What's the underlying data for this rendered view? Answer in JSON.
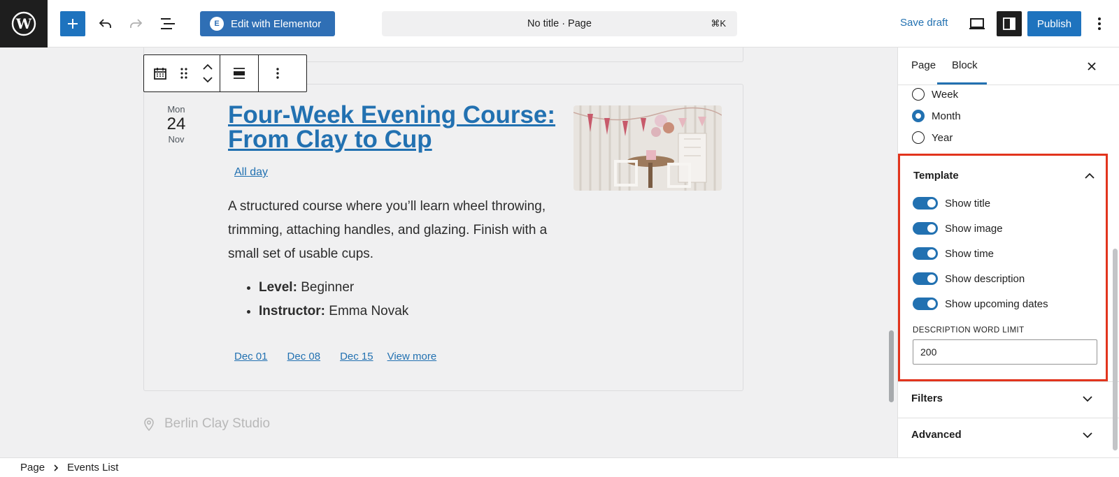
{
  "topbar": {
    "document_title": "No title · Page",
    "command_shortcut": "⌘K",
    "elementor_label": "Edit with Elementor",
    "save_draft_label": "Save draft",
    "publish_label": "Publish",
    "icons": [
      "wordpress-logo-icon",
      "plus-icon",
      "undo-icon",
      "redo-icon",
      "list-view-icon",
      "elementor-icon",
      "desktop-preview-icon",
      "settings-sidebar-icon",
      "more-vertical-icon"
    ]
  },
  "block_toolbar": {
    "icons": [
      "calendar-icon",
      "drag-handle-icon",
      "move-up-icon",
      "move-down-icon",
      "align-icon",
      "options-icon"
    ]
  },
  "event": {
    "day_of_week": "Mon",
    "day": "24",
    "month": "Nov",
    "title": "Four-Week Evening Course: From Clay to Cup",
    "time_label": "All day",
    "description": "A structured course where you’ll learn wheel throwing, trimming, attaching handles, and glazing. Finish with a small set of usable cups.",
    "details": [
      {
        "label": "Level:",
        "value": " Beginner"
      },
      {
        "label": "Instructor:",
        "value": " Emma Novak"
      }
    ],
    "upcoming_dates": [
      "Dec 01",
      "Dec 08",
      "Dec 15"
    ],
    "view_more_label": "View more",
    "location": "Berlin Clay Studio"
  },
  "sidebar": {
    "tabs": [
      {
        "label": "Page",
        "active": false
      },
      {
        "label": "Block",
        "active": true
      }
    ],
    "period_options": [
      {
        "label": "Week",
        "selected": false
      },
      {
        "label": "Month",
        "selected": true
      },
      {
        "label": "Year",
        "selected": false
      }
    ],
    "template_panel": {
      "title": "Template",
      "toggles": [
        {
          "label": "Show title",
          "on": true
        },
        {
          "label": "Show image",
          "on": true
        },
        {
          "label": "Show time",
          "on": true
        },
        {
          "label": "Show description",
          "on": true
        },
        {
          "label": "Show upcoming dates",
          "on": true
        }
      ],
      "word_limit_label": "DESCRIPTION WORD LIMIT",
      "word_limit_value": "200"
    },
    "filters_title": "Filters",
    "advanced_title": "Advanced"
  },
  "breadcrumb": {
    "items": [
      "Page",
      "Events List"
    ]
  },
  "colors": {
    "accent": "#2271b1",
    "highlight_border": "#e2341d",
    "dark": "#1e1e1e"
  }
}
